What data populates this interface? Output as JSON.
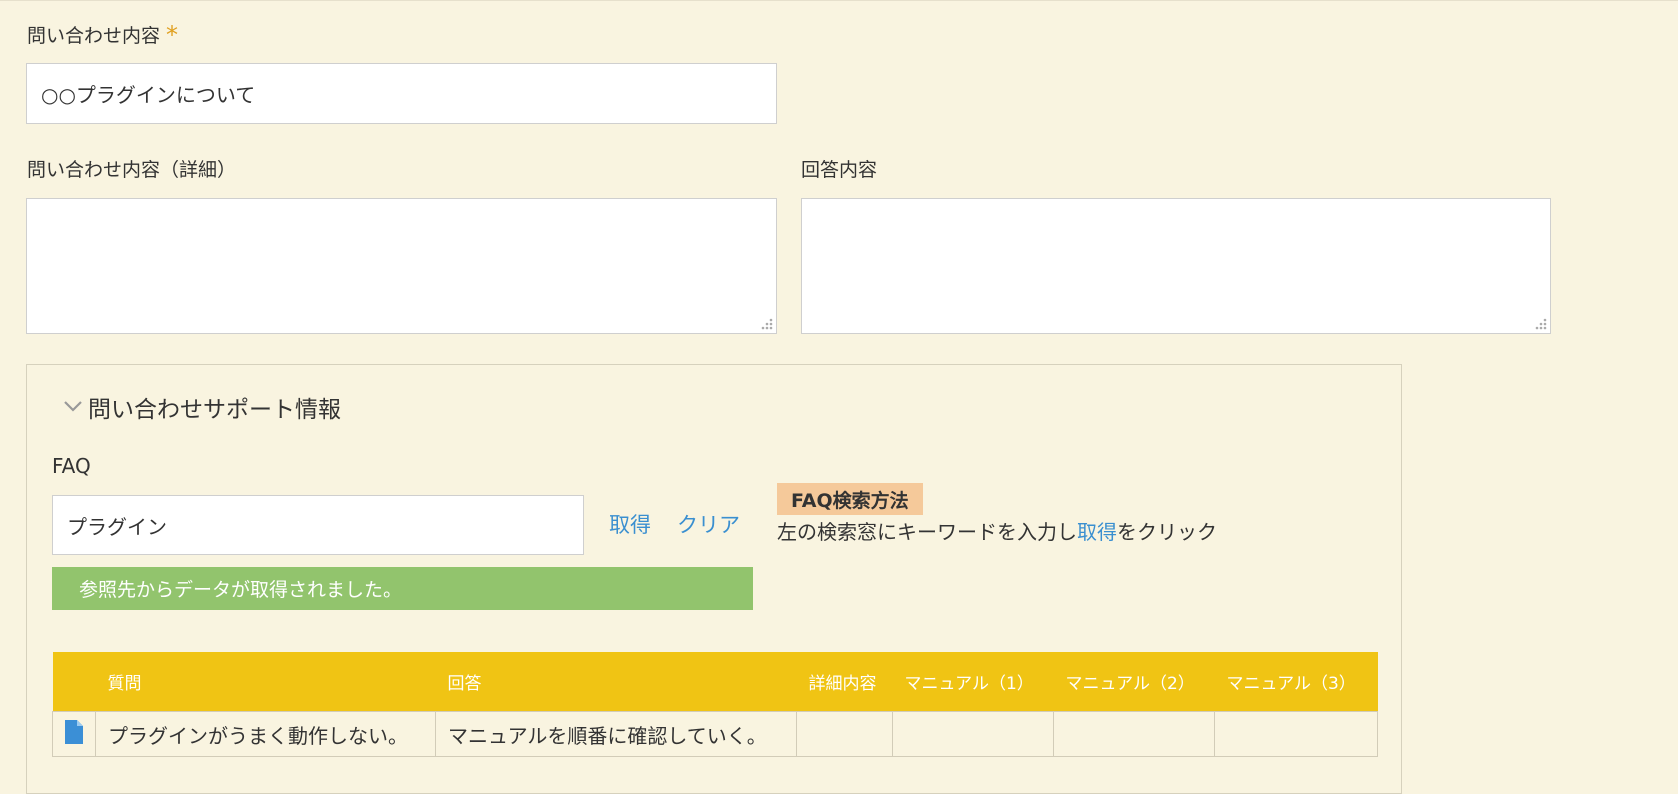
{
  "inquiry": {
    "label": "問い合わせ内容",
    "required_mark": "*",
    "value": "○○プラグインについて"
  },
  "details": {
    "label": "問い合わせ内容（詳細）",
    "value": ""
  },
  "answer": {
    "label": "回答内容",
    "value": ""
  },
  "support_panel": {
    "title": "問い合わせサポート情報",
    "faq_label": "FAQ",
    "search_value": "プラグイン",
    "get_label": "取得",
    "clear_label": "クリア",
    "help": {
      "badge": "FAQ検索方法",
      "text_before": "左の検索窓にキーワードを入力し",
      "text_link": "取得",
      "text_after": "をクリック"
    },
    "status_message": "参照先からデータが取得されました。"
  },
  "faq_table": {
    "columns": [
      "",
      "質問",
      "回答",
      "詳細内容",
      "マニュアル（1）",
      "マニュアル（2）",
      "マニュアル（3）"
    ],
    "rows": [
      {
        "icon": "document-icon",
        "question": "プラグインがうまく動作しない。",
        "answer": "マニュアルを順番に確認していく。",
        "detail": "",
        "manual1": "",
        "manual2": "",
        "manual3": ""
      }
    ]
  },
  "colors": {
    "background": "#f9f4e0",
    "table_header": "#f0c414",
    "success": "#92c46d",
    "badge": "#f5c99a",
    "link": "#3a8fd0",
    "required": "#e0a020"
  }
}
